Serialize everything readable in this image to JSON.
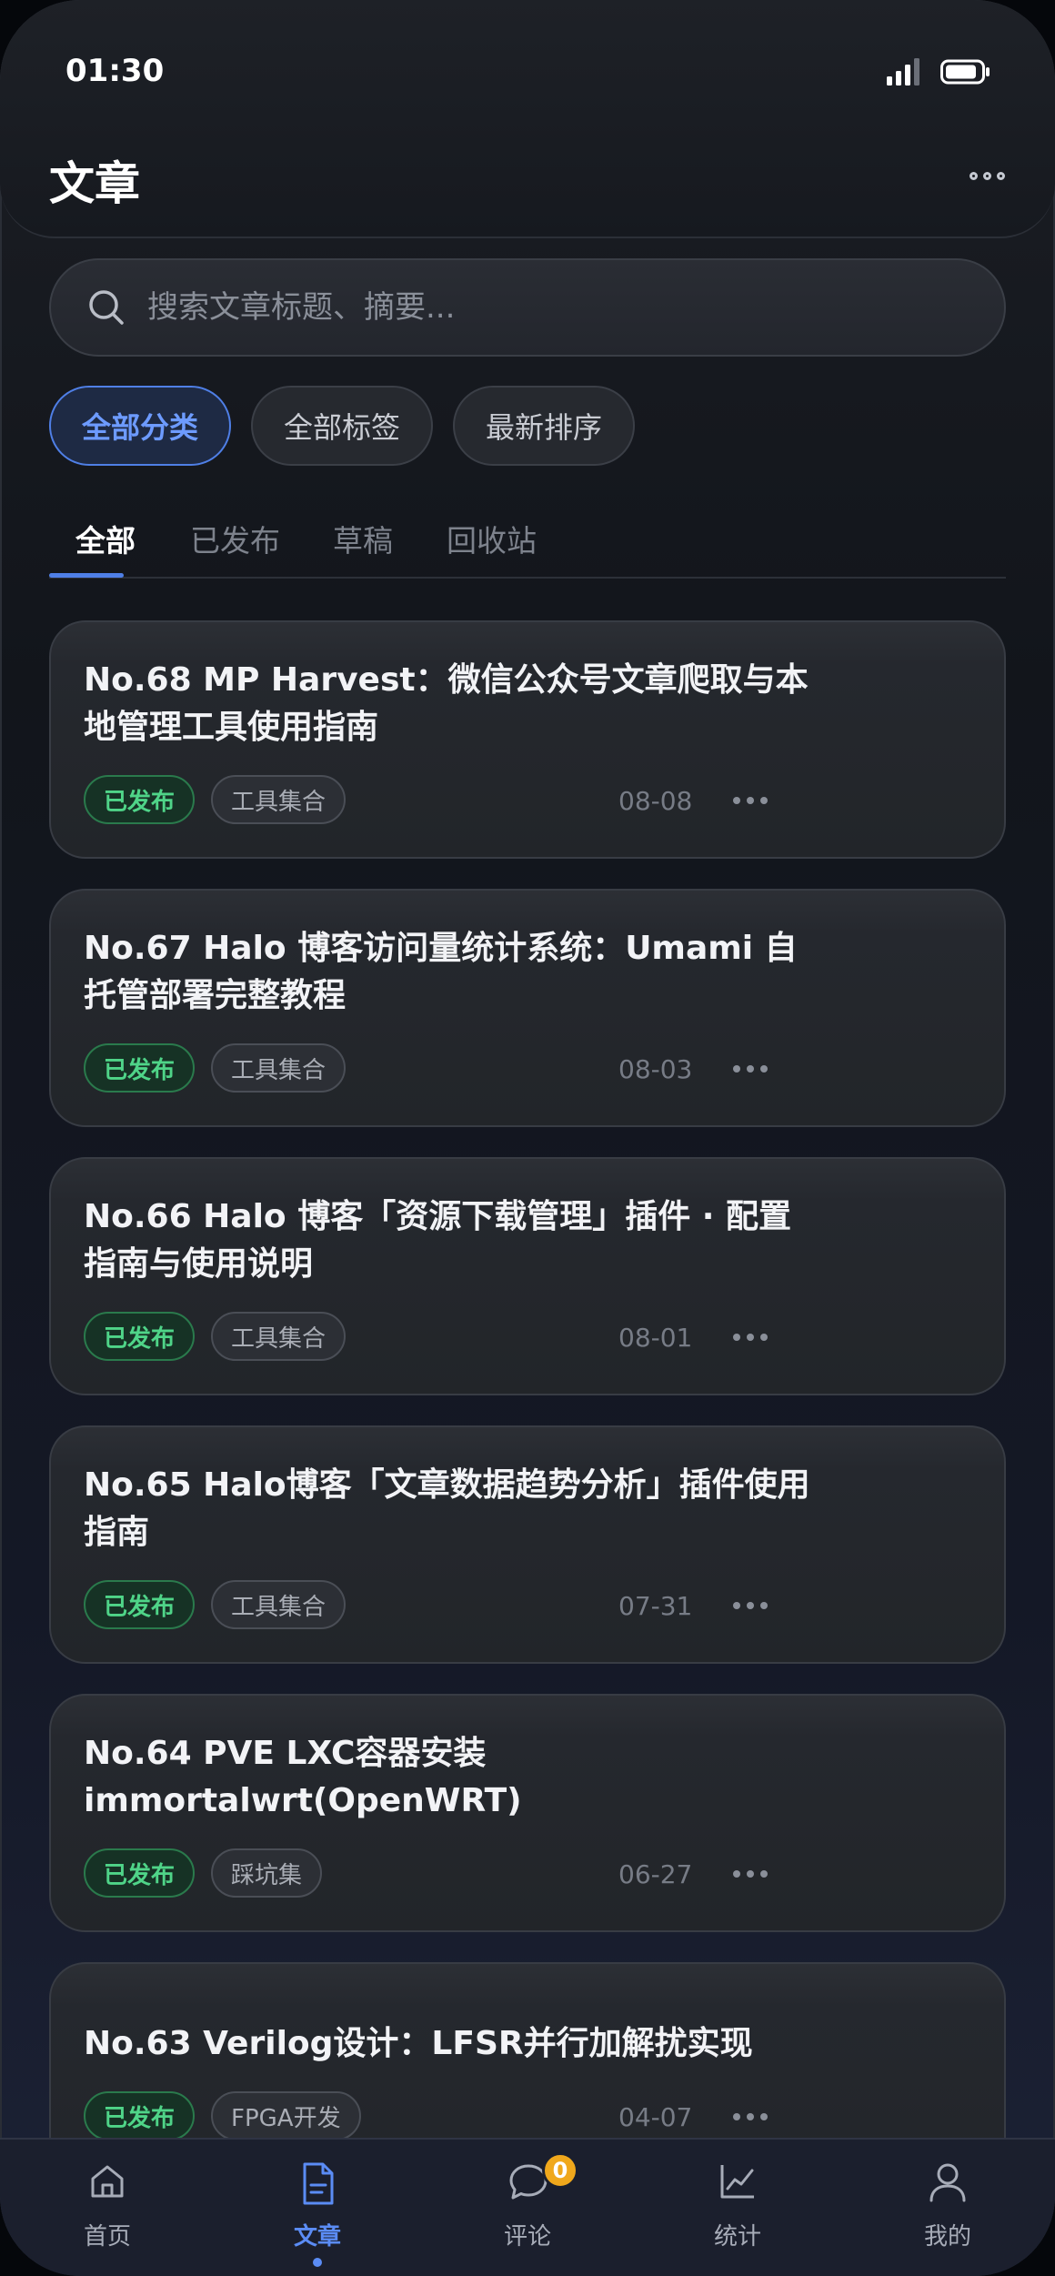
{
  "status_bar": {
    "time": "01:30"
  },
  "header": {
    "title": "文章"
  },
  "search": {
    "placeholder": "搜索文章标题、摘要..."
  },
  "filters": [
    {
      "label": "全部分类",
      "active": true
    },
    {
      "label": "全部标签",
      "active": false
    },
    {
      "label": "最新排序",
      "active": false
    }
  ],
  "tabs": [
    {
      "label": "全部",
      "active": true
    },
    {
      "label": "已发布",
      "active": false
    },
    {
      "label": "草稿",
      "active": false
    },
    {
      "label": "回收站",
      "active": false
    }
  ],
  "articles": [
    {
      "title": "No.68 MP Harvest：微信公众号文章爬取与本地管理工具使用指南",
      "status": "已发布",
      "category": "工具集合",
      "date": "08-08"
    },
    {
      "title": "No.67 Halo 博客访问量统计系统：Umami 自托管部署完整教程",
      "status": "已发布",
      "category": "工具集合",
      "date": "08-03"
    },
    {
      "title": "No.66 Halo 博客「资源下载管理」插件 · 配置指南与使用说明",
      "status": "已发布",
      "category": "工具集合",
      "date": "08-01"
    },
    {
      "title": "No.65 Halo博客「文章数据趋势分析」插件使用指南",
      "status": "已发布",
      "category": "工具集合",
      "date": "07-31"
    },
    {
      "title": "No.64 PVE LXC容器安装immortalwrt(OpenWRT)",
      "status": "已发布",
      "category": "踩坑集",
      "date": "06-27"
    },
    {
      "title": "No.63 Verilog设计：LFSR并行加解扰实现",
      "status": "已发布",
      "category": "FPGA开发",
      "date": "04-07"
    }
  ],
  "bottom_nav": [
    {
      "label": "首页",
      "icon": "home-icon",
      "active": false
    },
    {
      "label": "文章",
      "icon": "document-icon",
      "active": true
    },
    {
      "label": "评论",
      "icon": "comment-icon",
      "active": false,
      "badge": "0"
    },
    {
      "label": "统计",
      "icon": "chart-icon",
      "active": false
    },
    {
      "label": "我的",
      "icon": "user-icon",
      "active": false
    }
  ],
  "colors": {
    "accent": "#4f7fe6",
    "published": "#4fd488",
    "badge": "#f0a81c"
  }
}
